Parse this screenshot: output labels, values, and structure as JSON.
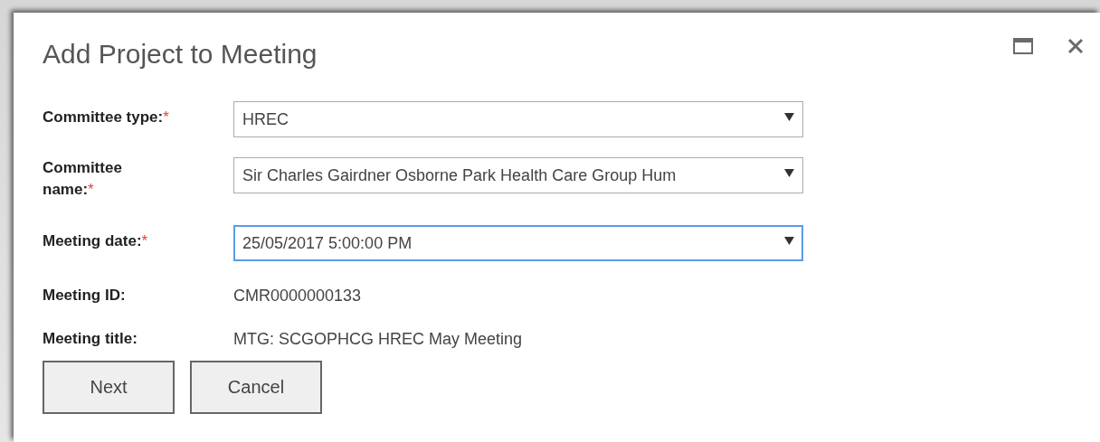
{
  "dialog": {
    "title": "Add Project to Meeting"
  },
  "fields": [
    {
      "kind": "select",
      "label": "Committee type:",
      "required_mark": "*",
      "value": "HREC",
      "focused": false
    },
    {
      "kind": "select",
      "label": "Committee name:",
      "required_mark": "*",
      "value": "Sir Charles Gairdner Osborne Park Health Care Group Hum",
      "focused": false
    },
    {
      "kind": "select",
      "label": "Meeting date:",
      "required_mark": "*",
      "value": "25/05/2017 5:00:00 PM",
      "focused": true
    },
    {
      "kind": "text",
      "label": "Meeting ID:",
      "value": "CMR0000000133"
    },
    {
      "kind": "text",
      "label": "Meeting title:",
      "value": "MTG: SCGOPHCG HREC May Meeting"
    }
  ],
  "buttons": [
    "Next",
    "Cancel"
  ]
}
